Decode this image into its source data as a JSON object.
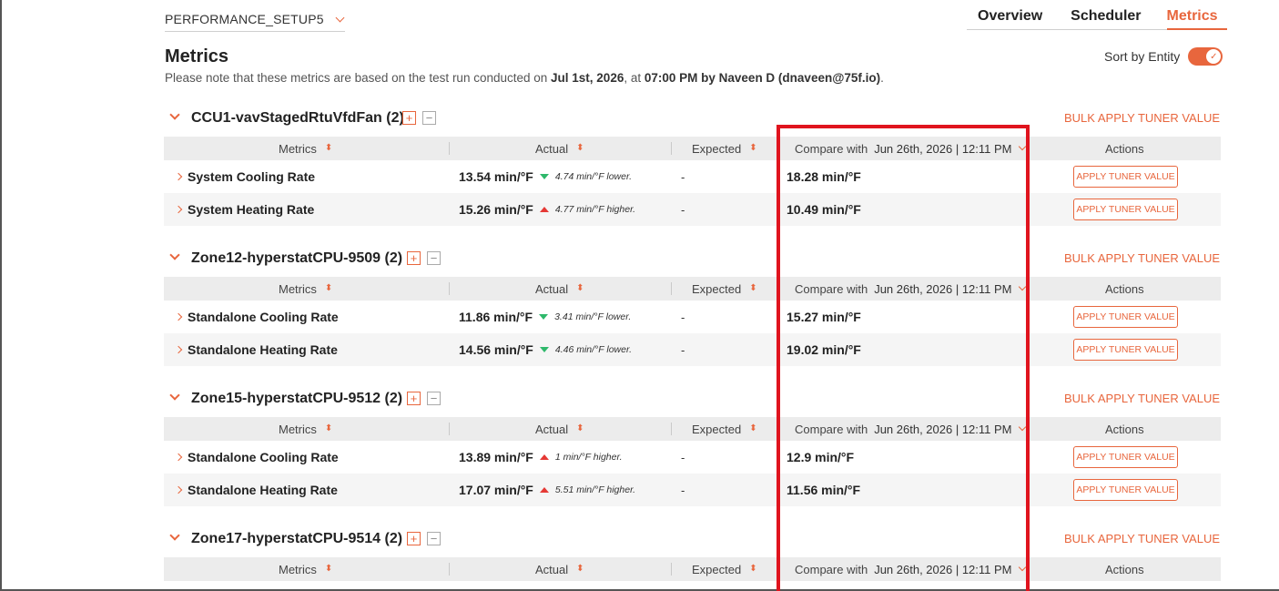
{
  "setup": {
    "value": "PERFORMANCE_SETUP5"
  },
  "tabs": [
    {
      "label": "Overview"
    },
    {
      "label": "Scheduler"
    },
    {
      "label": "Metrics"
    }
  ],
  "page": {
    "title": "Metrics",
    "note_prefix": "Please note that these metrics are based on the test run conducted on ",
    "note_date": "Jul 1st, 2026",
    "note_mid": ", at ",
    "note_time": "07:00 PM",
    "note_by": " by ",
    "note_user": "Naveen D (dnaveen@75f.io)",
    "note_suffix": "."
  },
  "sort": {
    "label": "Sort by Entity",
    "enabled": true
  },
  "table_headers": {
    "metrics": "Metrics",
    "actual": "Actual",
    "expected": "Expected",
    "compare_with": "Compare with",
    "compare_date": "Jun 26th, 2026 | 12:11 PM",
    "actions": "Actions"
  },
  "bulk_label": "BULK APPLY TUNER VALUE",
  "apply_label": "APPLY TUNER VALUE",
  "groups": [
    {
      "name": "CCU1-vavStagedRtuVfdFan (2)",
      "rows": [
        {
          "metric": "System Cooling Rate",
          "actual": "13.54 min/°F",
          "trend": "down",
          "diff": "4.74 min/°F lower.",
          "expected": "-",
          "compare": "18.28 min/°F"
        },
        {
          "metric": "System Heating Rate",
          "actual": "15.26 min/°F",
          "trend": "up",
          "diff": "4.77 min/°F higher.",
          "expected": "-",
          "compare": "10.49 min/°F"
        }
      ]
    },
    {
      "name": "Zone12-hyperstatCPU-9509 (2)",
      "rows": [
        {
          "metric": "Standalone Cooling Rate",
          "actual": "11.86 min/°F",
          "trend": "down",
          "diff": "3.41 min/°F lower.",
          "expected": "-",
          "compare": "15.27 min/°F"
        },
        {
          "metric": "Standalone Heating Rate",
          "actual": "14.56 min/°F",
          "trend": "down",
          "diff": "4.46 min/°F lower.",
          "expected": "-",
          "compare": "19.02 min/°F"
        }
      ]
    },
    {
      "name": "Zone15-hyperstatCPU-9512 (2)",
      "rows": [
        {
          "metric": "Standalone Cooling Rate",
          "actual": "13.89 min/°F",
          "trend": "up",
          "diff": "1 min/°F higher.",
          "expected": "-",
          "compare": "12.9 min/°F"
        },
        {
          "metric": "Standalone Heating Rate",
          "actual": "17.07 min/°F",
          "trend": "up",
          "diff": "5.51 min/°F higher.",
          "expected": "-",
          "compare": "11.56 min/°F"
        }
      ]
    },
    {
      "name": "Zone17-hyperstatCPU-9514 (2)",
      "rows": []
    }
  ],
  "colors": {
    "accent": "#e8663d",
    "highlight": "#e0141e",
    "trend_down": "#2eb86b",
    "trend_up": "#e53935"
  }
}
